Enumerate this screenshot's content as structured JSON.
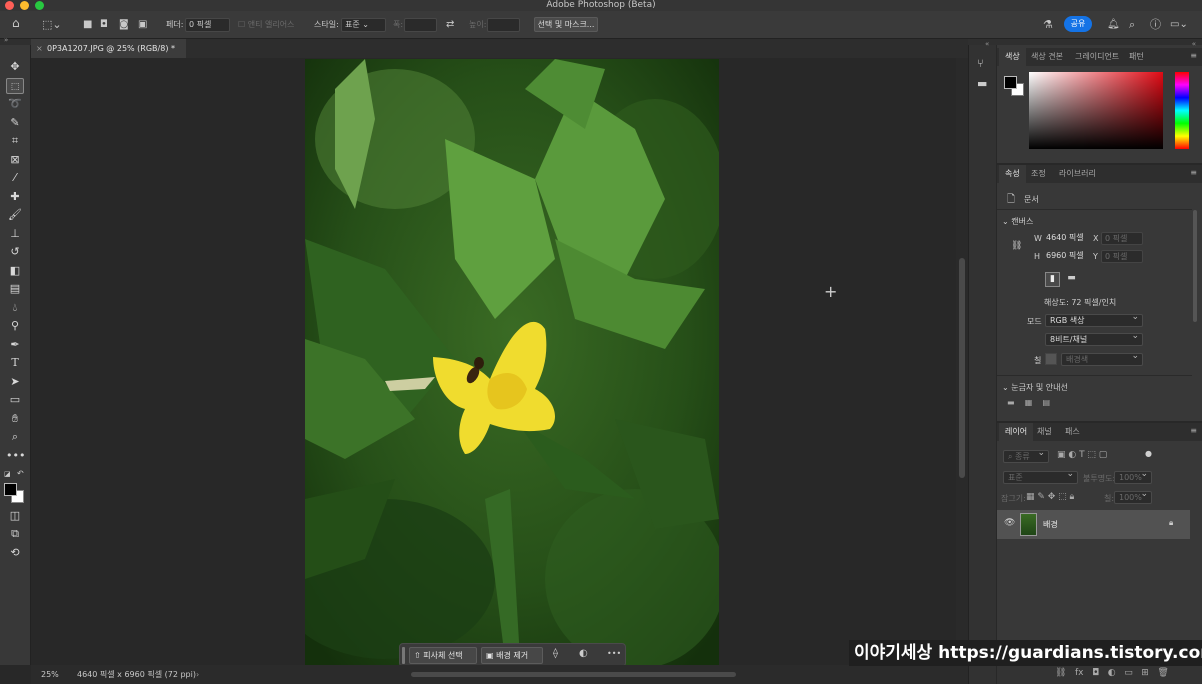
{
  "window": {
    "title": "Adobe Photoshop (Beta)"
  },
  "options_bar": {
    "feather_label": "페더:",
    "feather_value": "0 픽셀",
    "antialias_label": "앤티 앨리어스",
    "style_label": "스타일:",
    "style_value": "표준",
    "width_label": "폭:",
    "height_label": "높이:",
    "select_mask_label": "선택 및 마스크...",
    "share_label": "공유"
  },
  "document_tab": {
    "title": "0P3A1207.JPG @ 25% (RGB/8) *"
  },
  "status": {
    "zoom": "25%",
    "doc_info": "4640 픽셀 x 6960 픽셀 (72 ppi)"
  },
  "context_bar": {
    "select_subject": "피사체 선택",
    "remove_bg": "배경 제거",
    "more": "•••"
  },
  "color_panel": {
    "tabs": [
      "색상",
      "색상 견본",
      "그레이디언트",
      "패턴"
    ]
  },
  "properties_panel": {
    "tabs": [
      "속성",
      "조정",
      "라이브러리"
    ],
    "doc_label": "문서",
    "canvas_section": "캔버스",
    "w_label": "W",
    "w_value": "4640 픽셀",
    "h_label": "H",
    "h_value": "6960 픽셀",
    "x_label": "X",
    "x_placeholder": "0 픽셀",
    "y_label": "Y",
    "y_placeholder": "0 픽셀",
    "resolution": "해상도: 72 픽셀/인치",
    "mode_label": "모드",
    "mode_value": "RGB 색상",
    "depth_value": "8비트/채널",
    "fill_label": "칠",
    "fill_value": "배경색",
    "guides_section": "눈금자 및 안내선"
  },
  "layers_panel": {
    "tabs": [
      "레이어",
      "채널",
      "패스"
    ],
    "search_label": "종류",
    "blend_mode": "표준",
    "opacity_label": "불투명도:",
    "opacity_value": "100%",
    "lock_label": "잠그기:",
    "fill_label": "칠:",
    "fill_value": "100%",
    "layers": [
      {
        "name": "배경"
      }
    ]
  },
  "watermark": {
    "text": "이야기세상 https://guardians.tistory.com"
  },
  "colors": {
    "accent": "#1473e6",
    "panel_bg": "#383838",
    "canvas_bg": "#282828"
  }
}
